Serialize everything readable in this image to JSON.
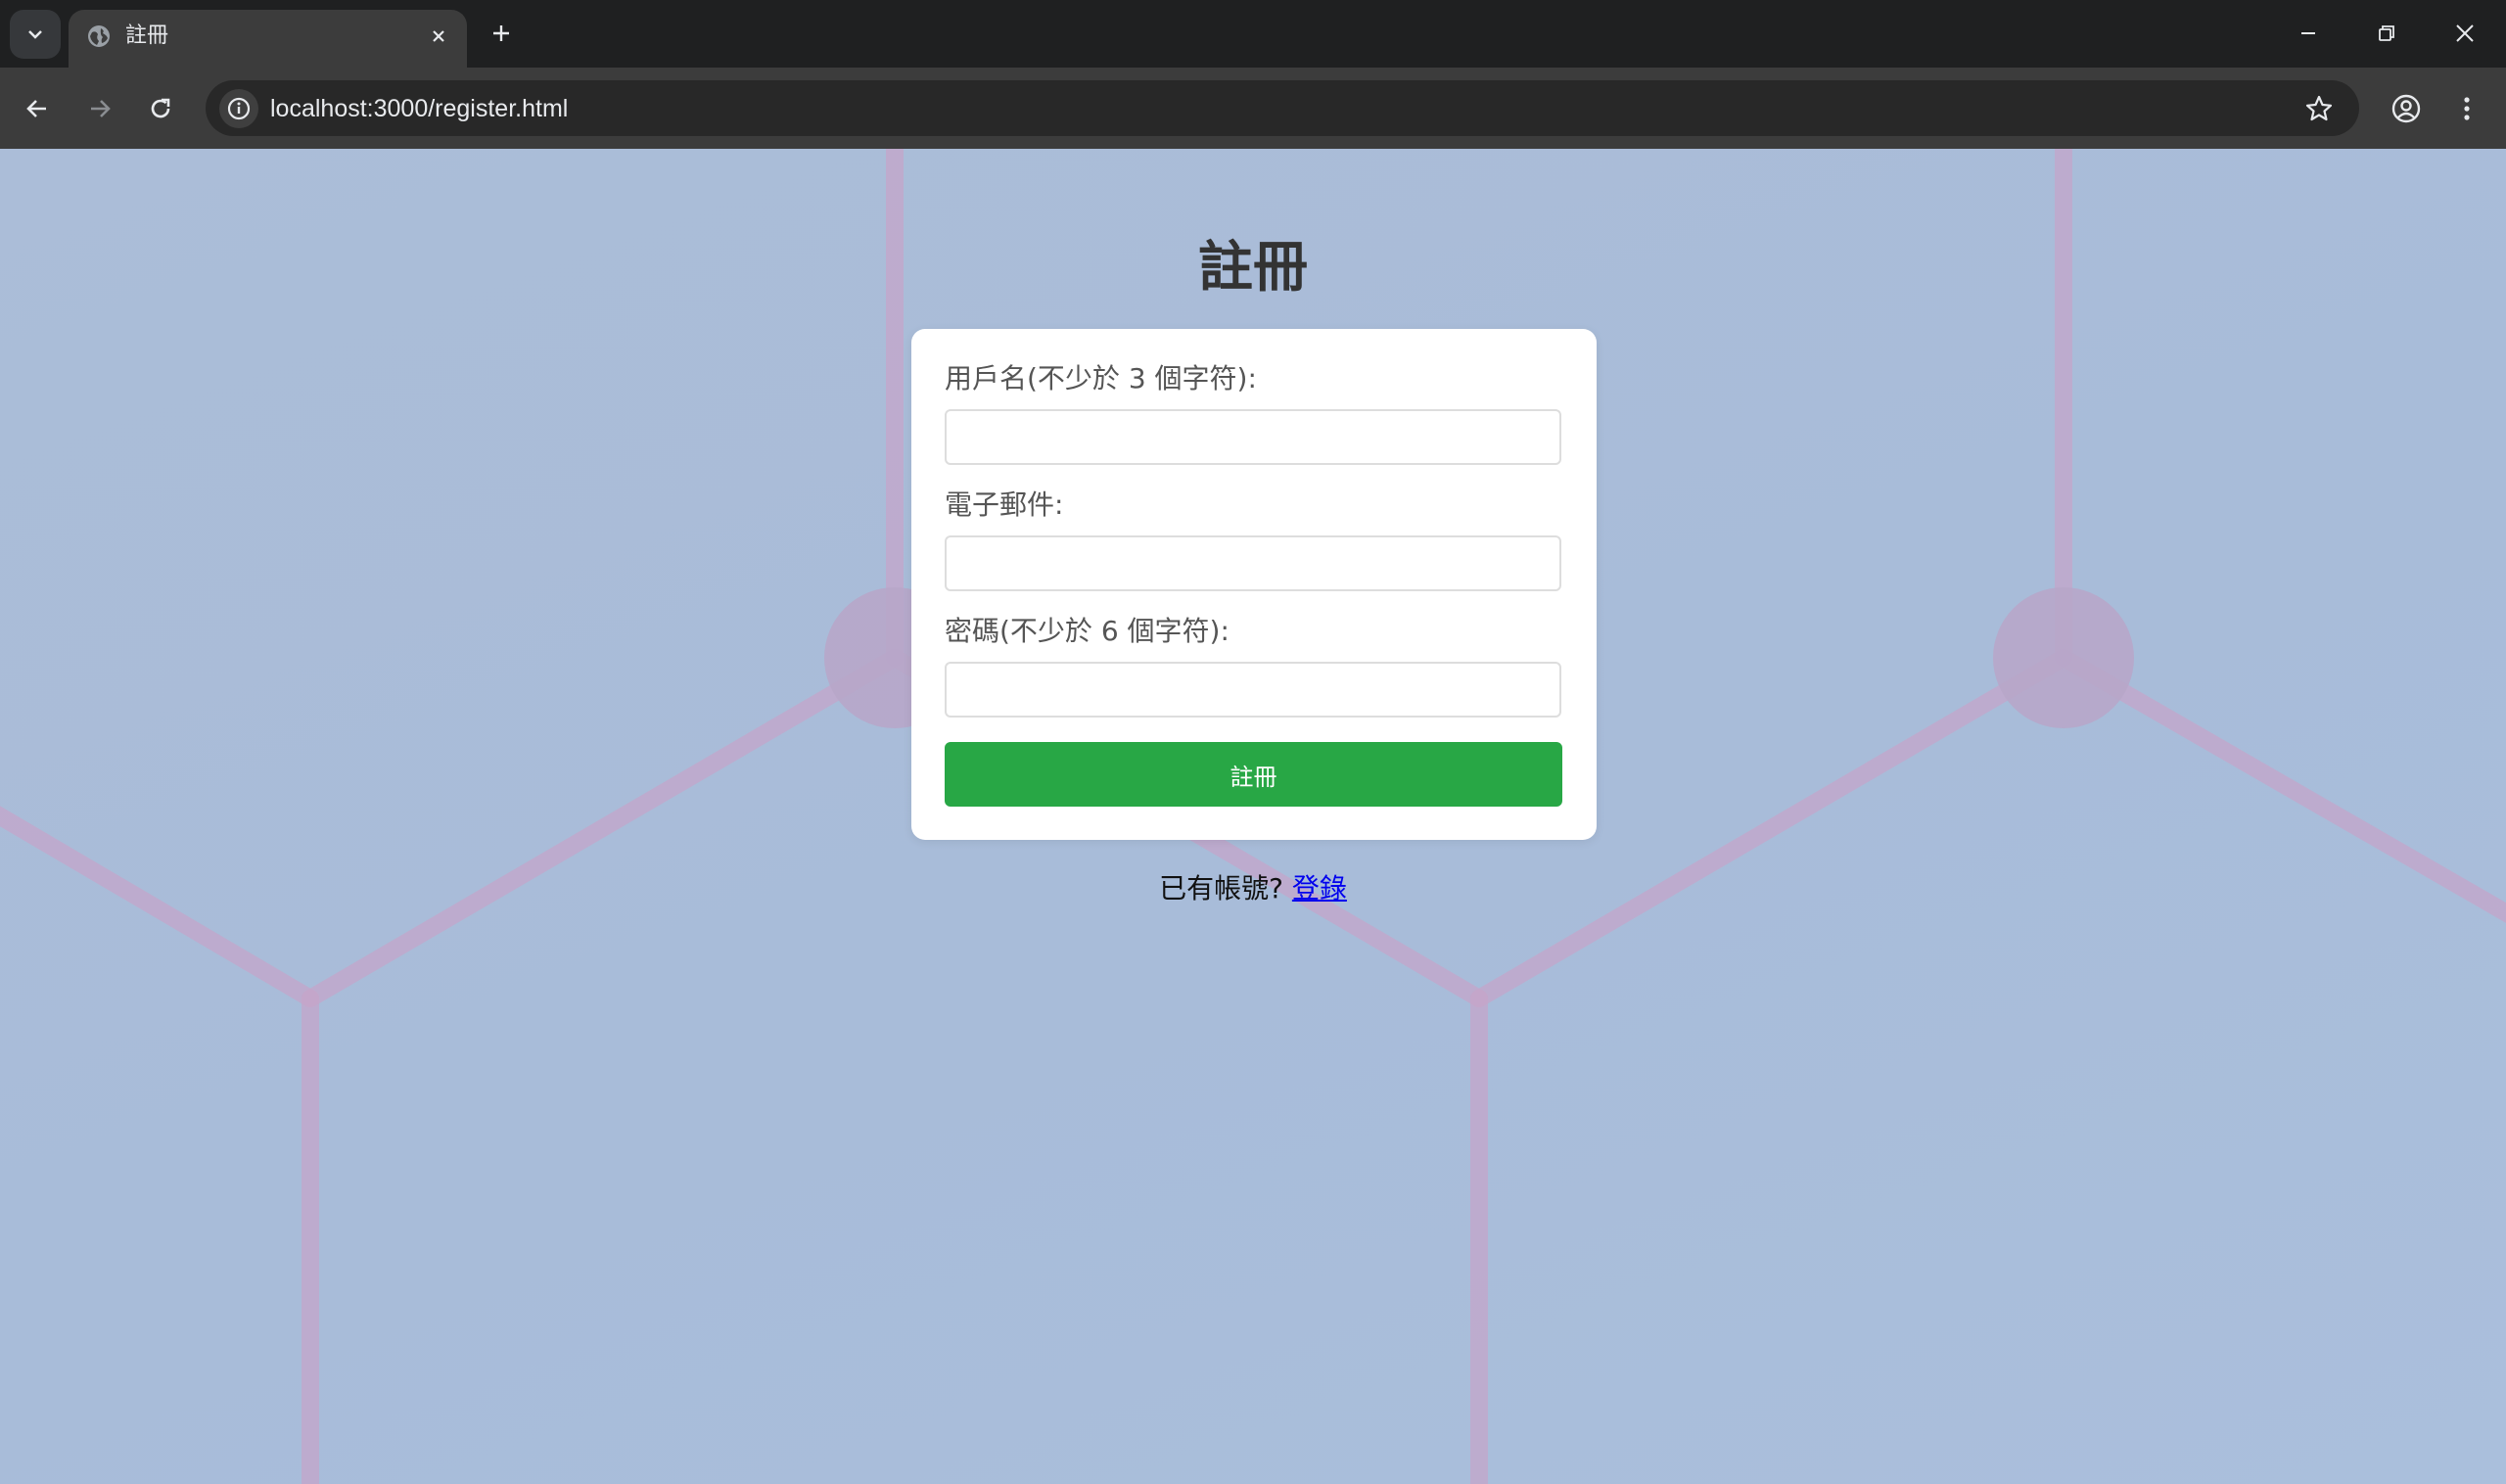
{
  "browser": {
    "tab_title": "註冊",
    "url": "localhost:3000/register.html"
  },
  "page": {
    "title": "註冊",
    "form": {
      "username_label": "用戶名(不少於 3 個字符):",
      "username_value": "",
      "email_label": "電子郵件:",
      "email_value": "",
      "password_label": "密碼(不少於 6 個字符):",
      "password_value": "",
      "submit_label": "註冊"
    },
    "login_prompt": "已有帳號?",
    "login_link": "登錄"
  },
  "colors": {
    "submit_button": "#28a745",
    "background": "#a9bcd8",
    "link": "#0000ee"
  },
  "icons": {
    "tab_menu": "chevron-down-icon",
    "favicon": "globe-icon",
    "tab_close": "close-icon",
    "new_tab": "plus-icon",
    "back": "arrow-left-icon",
    "forward": "arrow-right-icon",
    "reload": "reload-icon",
    "site_info": "info-icon",
    "bookmark": "star-icon",
    "profile": "account-icon",
    "menu": "kebab-menu-icon"
  }
}
